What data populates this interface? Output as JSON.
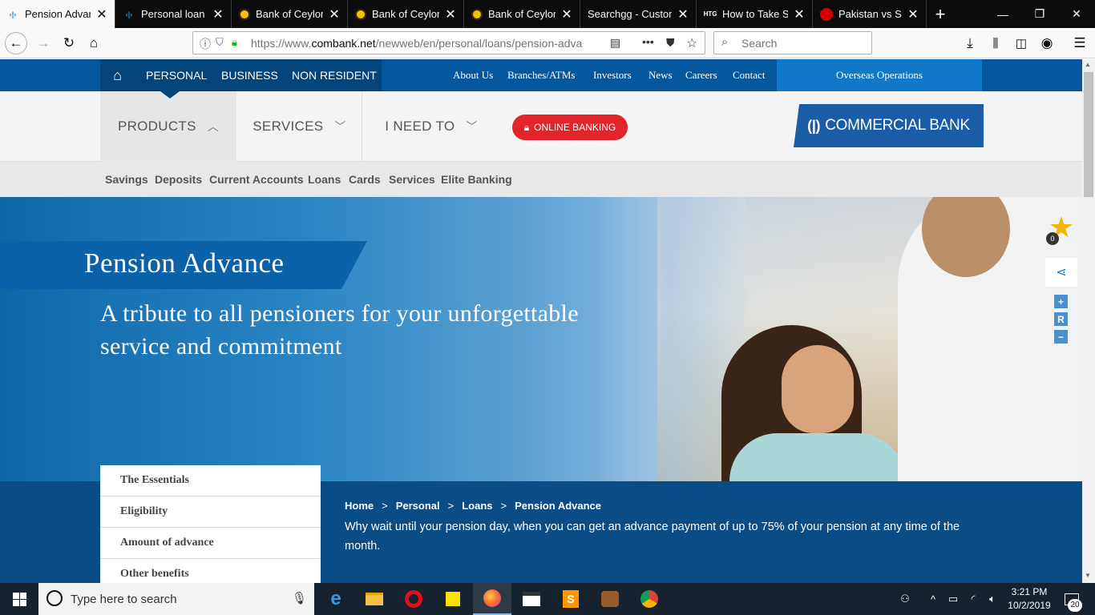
{
  "browser": {
    "tabs": [
      {
        "title": "Pension Advance",
        "favicon": "commercial-bank"
      },
      {
        "title": "Personal loan |",
        "favicon": "commercial-bank"
      },
      {
        "title": "Bank of Ceylon",
        "favicon": "bank-of-ceylon"
      },
      {
        "title": "Bank of Ceylon",
        "favicon": "bank-of-ceylon"
      },
      {
        "title": "Bank of Ceylon",
        "favicon": "bank-of-ceylon"
      },
      {
        "title": "Searchgg - Custom",
        "favicon": "none"
      },
      {
        "title": "How to Take Sc",
        "favicon": "htg",
        "fav_text": "HTG"
      },
      {
        "title": "Pakistan vs Sri L",
        "favicon": "flag"
      }
    ],
    "url_prefix": "https://www.",
    "url_domain": "combank.net",
    "url_rest": "/newweb/en/personal/loans/pension-adva",
    "search_placeholder": "Search"
  },
  "site": {
    "top_nav": [
      "PERSONAL",
      "BUSINESS",
      "NON RESIDENT"
    ],
    "utility_links": [
      "About Us",
      "Branches/ATMs",
      "Investors",
      "News",
      "Careers",
      "Contact"
    ],
    "overseas": "Overseas Operations",
    "main_nav": [
      "PRODUCTS",
      "SERVICES",
      "I NEED TO"
    ],
    "online_banking": "ONLINE BANKING",
    "logo_text": "COMMERCIAL BANK",
    "sub_nav": [
      "Savings",
      "Deposits",
      "Current Accounts",
      "Loans",
      "Cards",
      "Services",
      "Elite Banking"
    ]
  },
  "hero": {
    "title": "Pension Advance",
    "tagline": "A tribute to all pensioners for your unforgettable service and commitment",
    "favorites_count": "0",
    "zoom_reset": "R"
  },
  "side_menu": [
    "The Essentials",
    "Eligibility",
    "Amount of advance",
    "Other benefits"
  ],
  "breadcrumb": [
    "Home",
    "Personal",
    "Loans",
    "Pension Advance"
  ],
  "intro": "Why wait until your pension day, when you can get an advance payment of up to 75% of your pension at any time of the month.",
  "taskbar": {
    "search_placeholder": "Type here to search",
    "time": "3:21 PM",
    "date": "10/2/2019",
    "notifications": "20"
  },
  "colors": {
    "brand_blue": "#05579d",
    "brand_dark": "#03447a",
    "online_red": "#e3252b",
    "star": "#f2b705"
  }
}
